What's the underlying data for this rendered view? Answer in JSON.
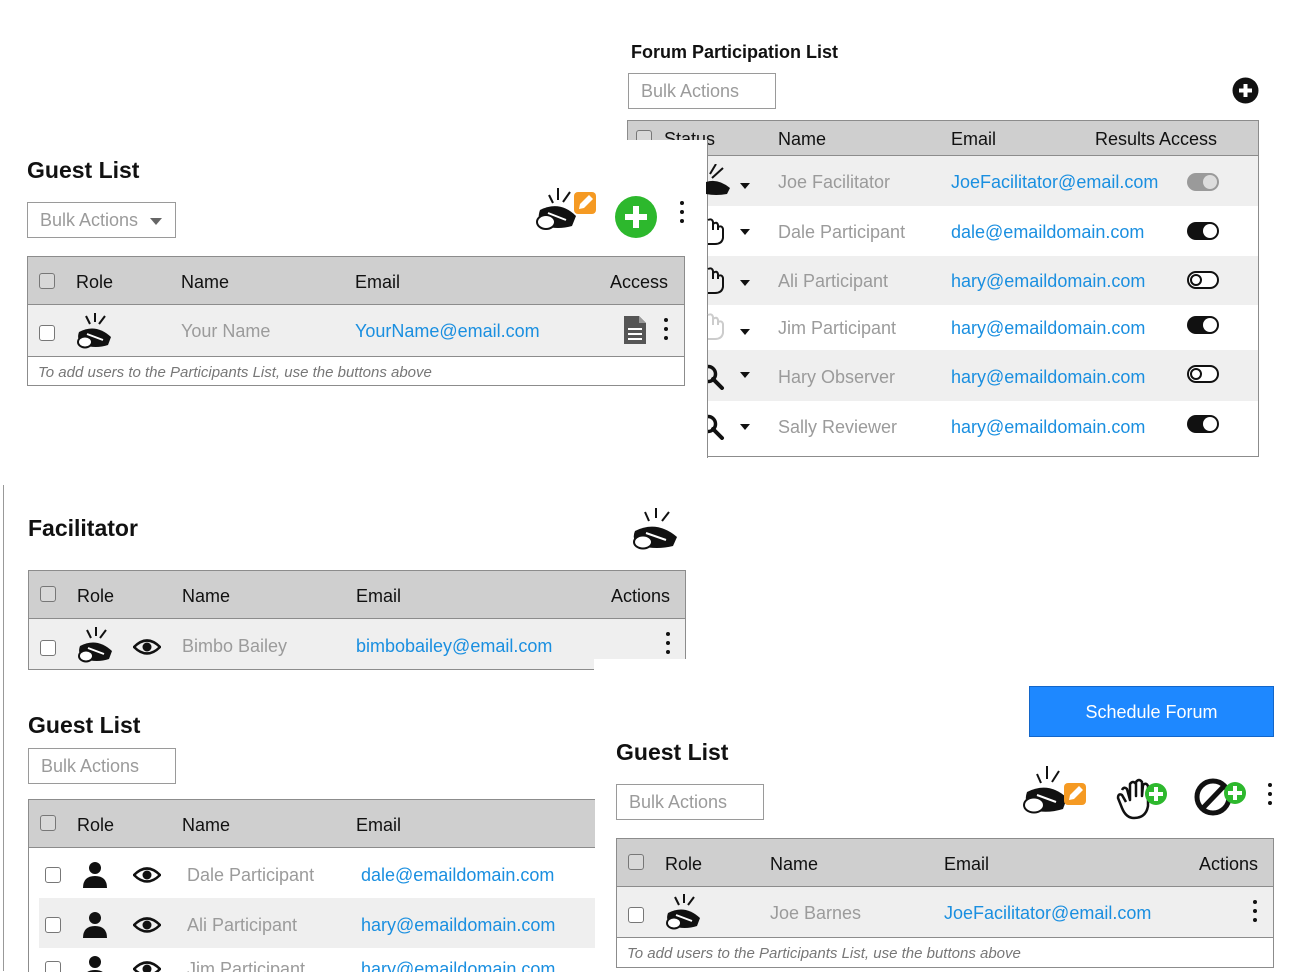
{
  "forum_list": {
    "title": "Forum Participation List",
    "bulk_actions": "Bulk Actions",
    "columns": [
      "Status",
      "Name",
      "Email",
      "Results Access"
    ],
    "rows": [
      {
        "name": "Joe Facilitator",
        "email": "JoeFacilitator@email.com",
        "access": "disabled-on"
      },
      {
        "name": "Dale Participant",
        "email": "dale@emaildomain.com",
        "access": "on"
      },
      {
        "name": "Ali Participant",
        "email": "hary@emaildomain.com",
        "access": "off"
      },
      {
        "name": "Jim Participant",
        "email": "hary@emaildomain.com",
        "access": "on"
      },
      {
        "name": "Hary Observer",
        "email": "hary@emaildomain.com",
        "access": "off"
      },
      {
        "name": "Sally Reviewer",
        "email": "hary@emaildomain.com",
        "access": "on"
      }
    ]
  },
  "guest_list_top": {
    "title": "Guest List",
    "bulk_actions": "Bulk Actions",
    "columns": [
      "Role",
      "Name",
      "Email",
      "Access"
    ],
    "rows": [
      {
        "name": "Your Name",
        "email": "YourName@email.com"
      }
    ],
    "note": "To add users to the Participants List, use the buttons above"
  },
  "facilitator": {
    "title": "Facilitator",
    "columns": [
      "Role",
      "Name",
      "Email",
      "Actions"
    ],
    "rows": [
      {
        "name": "Bimbo Bailey",
        "email": "bimbobailey@email.com"
      }
    ]
  },
  "guest_list_bottom_left": {
    "title": "Guest List",
    "bulk_actions": "Bulk Actions",
    "columns": [
      "Role",
      "Name",
      "Email"
    ],
    "rows": [
      {
        "name": "Dale Participant",
        "email": "dale@emaildomain.com"
      },
      {
        "name": "Ali Participant",
        "email": "hary@emaildomain.com"
      },
      {
        "name": "Jim Participant",
        "email": "hary@emaildomain.com"
      }
    ]
  },
  "guest_list_bottom_right": {
    "title": "Guest List",
    "bulk_actions": "Bulk Actions",
    "schedule_button": "Schedule Forum",
    "columns": [
      "Role",
      "Name",
      "Email",
      "Actions"
    ],
    "rows": [
      {
        "name": "Joe Barnes",
        "email": "JoeFacilitator@email.com"
      }
    ],
    "note": "To add users to the Participants List, use the buttons above"
  },
  "colors": {
    "accent_blue": "#1e88ff",
    "link": "#1a8fe0",
    "add_green": "#2db82d",
    "edit_orange": "#f59a23",
    "header_gray": "#cfcfcf"
  },
  "icons": [
    "whistle-icon",
    "hand-icon",
    "magnifier-icon",
    "document-icon",
    "eye-icon",
    "person-icon",
    "plus-circle-icon",
    "kebab-menu-icon",
    "no-entry-icon",
    "pencil-icon"
  ]
}
